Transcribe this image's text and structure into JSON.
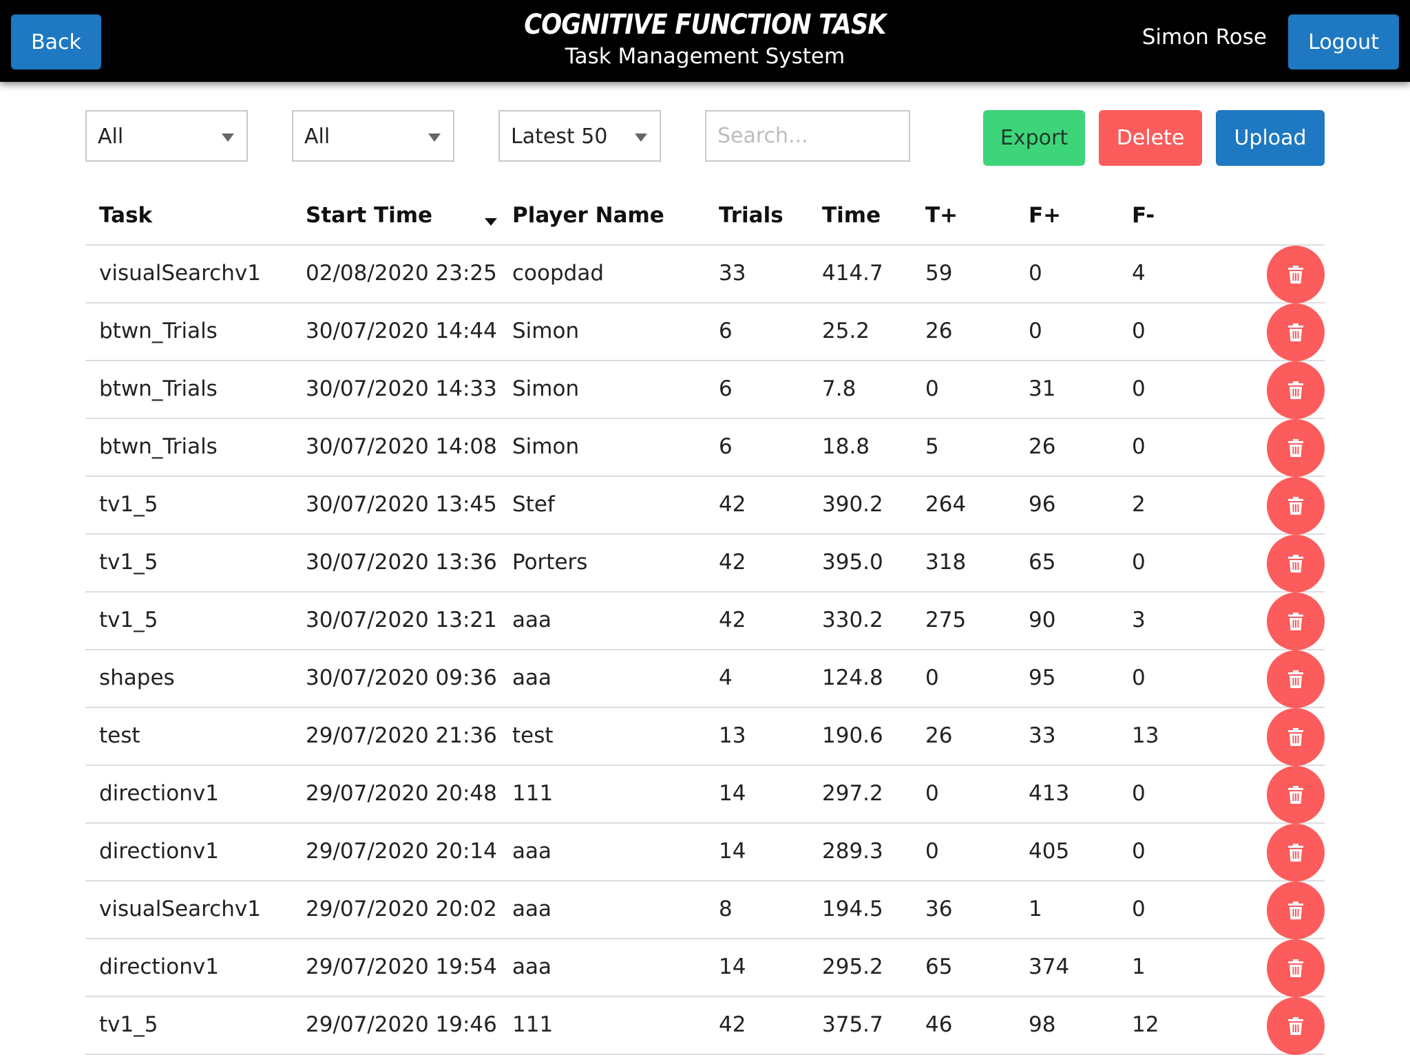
{
  "header": {
    "back_label": "Back",
    "title": "COGNITIVE FUNCTION TASK",
    "subtitle": "Task Management System",
    "user_name": "Simon Rose",
    "logout_label": "Logout"
  },
  "toolbar": {
    "filter1_value": "All",
    "filter2_value": "All",
    "limit_value": "Latest 50",
    "search_placeholder": "Search...",
    "export_label": "Export",
    "delete_label": "Delete",
    "upload_label": "Upload"
  },
  "table": {
    "columns": [
      "Task",
      "Start Time",
      "Player Name",
      "Trials",
      "Time",
      "T+",
      "F+",
      "F-"
    ],
    "rows": [
      [
        "visualSearchv1",
        "02/08/2020 23:25",
        "coopdad",
        "33",
        "414.7",
        "59",
        "0",
        "4"
      ],
      [
        "btwn_Trials",
        "30/07/2020 14:44",
        "Simon",
        "6",
        "25.2",
        "26",
        "0",
        "0"
      ],
      [
        "btwn_Trials",
        "30/07/2020 14:33",
        "Simon",
        "6",
        "7.8",
        "0",
        "31",
        "0"
      ],
      [
        "btwn_Trials",
        "30/07/2020 14:08",
        "Simon",
        "6",
        "18.8",
        "5",
        "26",
        "0"
      ],
      [
        "tv1_5",
        "30/07/2020 13:45",
        "Stef",
        "42",
        "390.2",
        "264",
        "96",
        "2"
      ],
      [
        "tv1_5",
        "30/07/2020 13:36",
        "Porters",
        "42",
        "395.0",
        "318",
        "65",
        "0"
      ],
      [
        "tv1_5",
        "30/07/2020 13:21",
        "aaa",
        "42",
        "330.2",
        "275",
        "90",
        "3"
      ],
      [
        "shapes",
        "30/07/2020 09:36",
        "aaa",
        "4",
        "124.8",
        "0",
        "95",
        "0"
      ],
      [
        "test",
        "29/07/2020 21:36",
        "test",
        "13",
        "190.6",
        "26",
        "33",
        "13"
      ],
      [
        "directionv1",
        "29/07/2020 20:48",
        "111",
        "14",
        "297.2",
        "0",
        "413",
        "0"
      ],
      [
        "directionv1",
        "29/07/2020 20:14",
        "aaa",
        "14",
        "289.3",
        "0",
        "405",
        "0"
      ],
      [
        "visualSearchv1",
        "29/07/2020 20:02",
        "aaa",
        "8",
        "194.5",
        "36",
        "1",
        "0"
      ],
      [
        "directionv1",
        "29/07/2020 19:54",
        "aaa",
        "14",
        "295.2",
        "65",
        "374",
        "1"
      ],
      [
        "tv1_5",
        "29/07/2020 19:46",
        "111",
        "42",
        "375.7",
        "46",
        "98",
        "12"
      ]
    ],
    "row_action_icon": "trash-icon"
  },
  "colors": {
    "header_bg": "#000000",
    "primary_blue": "#1e78c2",
    "export_green": "#3ed57a",
    "delete_red": "#fc5c5c"
  }
}
